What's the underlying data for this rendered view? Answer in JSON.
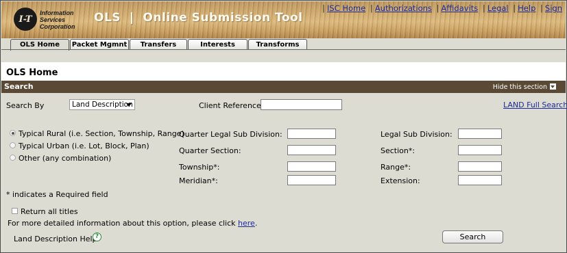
{
  "header": {
    "logo_mark": "I-T",
    "logo_lines": [
      "Information",
      "Services",
      "Corporation"
    ],
    "app_title": "OLS  |  Online Submission Tool",
    "links": [
      "ISC Home",
      "Authorizations",
      "Affidavits",
      "Legal",
      "Help",
      "Sign"
    ]
  },
  "tabs": [
    "OLS Home",
    "Packet Mgmnt",
    "Transfers",
    "Interests",
    "Transforms"
  ],
  "page_title": "OLS Home",
  "section": {
    "title": "Search",
    "hide_label": "Hide this section"
  },
  "form": {
    "search_by_label": "Search By",
    "search_by_value": "Land Description",
    "client_reference_label": "Client Reference:",
    "land_full_search_link": "LAND Full Search",
    "radio_options": [
      "Typical Rural (i.e. Section, Township, Range)",
      "Typical Urban (i.e. Lot, Block, Plan)",
      "Other (any combination)"
    ],
    "fields_left": [
      "Quarter Legal Sub Division:",
      "Quarter Section:",
      "Township*:",
      "Meridian*:"
    ],
    "fields_right": [
      "Legal Sub Division:",
      "Section*:",
      "Range*:",
      "Extension:"
    ],
    "required_note": "* indicates a Required field",
    "return_all_titles": "Return all titles",
    "more_info_text": "For more detailed information about this option, please click",
    "more_info_link": "here",
    "more_info_end": ".",
    "help_label": "Land Description Help",
    "search_button": "Search"
  }
}
